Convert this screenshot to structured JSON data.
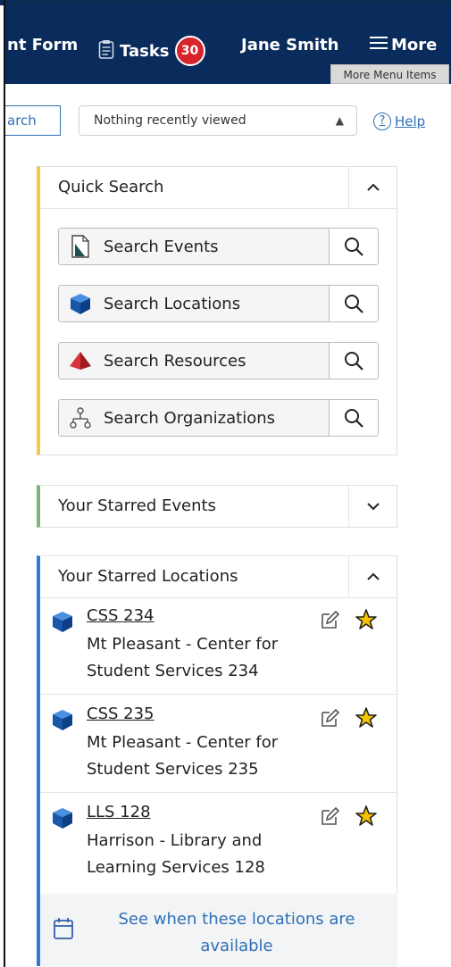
{
  "topbar": {
    "form_label": "nt Form",
    "tasks_label": "Tasks",
    "tasks_count": "30",
    "user_name": "Jane Smith",
    "more_label": "More",
    "more_tooltip": "More Menu Items"
  },
  "subbar": {
    "search_label": "arch",
    "recent_value": "Nothing recently viewed",
    "help_label": "Help"
  },
  "quick_search": {
    "title": "Quick Search",
    "items": [
      {
        "label": "Search Events",
        "icon": "event-icon"
      },
      {
        "label": "Search Locations",
        "icon": "location-cube-icon"
      },
      {
        "label": "Search Resources",
        "icon": "resource-pyramid-icon"
      },
      {
        "label": "Search Organizations",
        "icon": "organization-icon"
      }
    ]
  },
  "starred_events": {
    "title": "Your Starred Events"
  },
  "starred_locations": {
    "title": "Your Starred Locations",
    "items": [
      {
        "name": "CSS 234",
        "desc": "Mt Pleasant - Center for Student Services 234"
      },
      {
        "name": "CSS 235",
        "desc": "Mt Pleasant - Center for Student Services 235"
      },
      {
        "name": "LLS 128",
        "desc": "Harrison - Library and Learning Services 128"
      }
    ],
    "availability_link": "See when these locations are available"
  },
  "colors": {
    "nav_bg": "#0a2c5c",
    "badge": "#d8232a",
    "link": "#2f6fb6",
    "quick_search_accent": "#f2c94c",
    "starred_events_accent": "#7fb37a",
    "starred_locations_accent": "#2f7ad6",
    "star": "#f4c400"
  }
}
